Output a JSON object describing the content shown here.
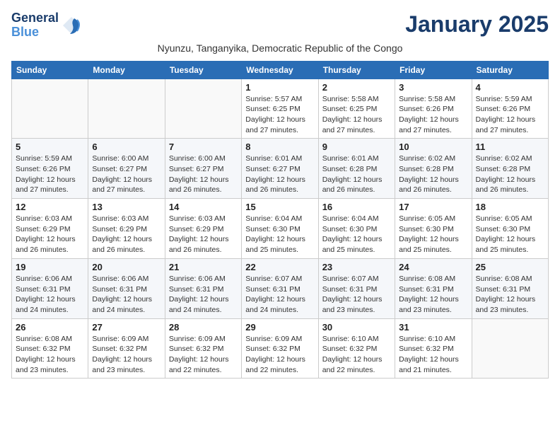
{
  "header": {
    "logo_line1": "General",
    "logo_line2": "Blue",
    "month_title": "January 2025",
    "subtitle": "Nyunzu, Tanganyika, Democratic Republic of the Congo"
  },
  "weekdays": [
    "Sunday",
    "Monday",
    "Tuesday",
    "Wednesday",
    "Thursday",
    "Friday",
    "Saturday"
  ],
  "weeks": [
    [
      {
        "day": "",
        "info": ""
      },
      {
        "day": "",
        "info": ""
      },
      {
        "day": "",
        "info": ""
      },
      {
        "day": "1",
        "info": "Sunrise: 5:57 AM\nSunset: 6:25 PM\nDaylight: 12 hours\nand 27 minutes."
      },
      {
        "day": "2",
        "info": "Sunrise: 5:58 AM\nSunset: 6:25 PM\nDaylight: 12 hours\nand 27 minutes."
      },
      {
        "day": "3",
        "info": "Sunrise: 5:58 AM\nSunset: 6:26 PM\nDaylight: 12 hours\nand 27 minutes."
      },
      {
        "day": "4",
        "info": "Sunrise: 5:59 AM\nSunset: 6:26 PM\nDaylight: 12 hours\nand 27 minutes."
      }
    ],
    [
      {
        "day": "5",
        "info": "Sunrise: 5:59 AM\nSunset: 6:26 PM\nDaylight: 12 hours\nand 27 minutes."
      },
      {
        "day": "6",
        "info": "Sunrise: 6:00 AM\nSunset: 6:27 PM\nDaylight: 12 hours\nand 27 minutes."
      },
      {
        "day": "7",
        "info": "Sunrise: 6:00 AM\nSunset: 6:27 PM\nDaylight: 12 hours\nand 26 minutes."
      },
      {
        "day": "8",
        "info": "Sunrise: 6:01 AM\nSunset: 6:27 PM\nDaylight: 12 hours\nand 26 minutes."
      },
      {
        "day": "9",
        "info": "Sunrise: 6:01 AM\nSunset: 6:28 PM\nDaylight: 12 hours\nand 26 minutes."
      },
      {
        "day": "10",
        "info": "Sunrise: 6:02 AM\nSunset: 6:28 PM\nDaylight: 12 hours\nand 26 minutes."
      },
      {
        "day": "11",
        "info": "Sunrise: 6:02 AM\nSunset: 6:28 PM\nDaylight: 12 hours\nand 26 minutes."
      }
    ],
    [
      {
        "day": "12",
        "info": "Sunrise: 6:03 AM\nSunset: 6:29 PM\nDaylight: 12 hours\nand 26 minutes."
      },
      {
        "day": "13",
        "info": "Sunrise: 6:03 AM\nSunset: 6:29 PM\nDaylight: 12 hours\nand 26 minutes."
      },
      {
        "day": "14",
        "info": "Sunrise: 6:03 AM\nSunset: 6:29 PM\nDaylight: 12 hours\nand 26 minutes."
      },
      {
        "day": "15",
        "info": "Sunrise: 6:04 AM\nSunset: 6:30 PM\nDaylight: 12 hours\nand 25 minutes."
      },
      {
        "day": "16",
        "info": "Sunrise: 6:04 AM\nSunset: 6:30 PM\nDaylight: 12 hours\nand 25 minutes."
      },
      {
        "day": "17",
        "info": "Sunrise: 6:05 AM\nSunset: 6:30 PM\nDaylight: 12 hours\nand 25 minutes."
      },
      {
        "day": "18",
        "info": "Sunrise: 6:05 AM\nSunset: 6:30 PM\nDaylight: 12 hours\nand 25 minutes."
      }
    ],
    [
      {
        "day": "19",
        "info": "Sunrise: 6:06 AM\nSunset: 6:31 PM\nDaylight: 12 hours\nand 24 minutes."
      },
      {
        "day": "20",
        "info": "Sunrise: 6:06 AM\nSunset: 6:31 PM\nDaylight: 12 hours\nand 24 minutes."
      },
      {
        "day": "21",
        "info": "Sunrise: 6:06 AM\nSunset: 6:31 PM\nDaylight: 12 hours\nand 24 minutes."
      },
      {
        "day": "22",
        "info": "Sunrise: 6:07 AM\nSunset: 6:31 PM\nDaylight: 12 hours\nand 24 minutes."
      },
      {
        "day": "23",
        "info": "Sunrise: 6:07 AM\nSunset: 6:31 PM\nDaylight: 12 hours\nand 23 minutes."
      },
      {
        "day": "24",
        "info": "Sunrise: 6:08 AM\nSunset: 6:31 PM\nDaylight: 12 hours\nand 23 minutes."
      },
      {
        "day": "25",
        "info": "Sunrise: 6:08 AM\nSunset: 6:31 PM\nDaylight: 12 hours\nand 23 minutes."
      }
    ],
    [
      {
        "day": "26",
        "info": "Sunrise: 6:08 AM\nSunset: 6:32 PM\nDaylight: 12 hours\nand 23 minutes."
      },
      {
        "day": "27",
        "info": "Sunrise: 6:09 AM\nSunset: 6:32 PM\nDaylight: 12 hours\nand 23 minutes."
      },
      {
        "day": "28",
        "info": "Sunrise: 6:09 AM\nSunset: 6:32 PM\nDaylight: 12 hours\nand 22 minutes."
      },
      {
        "day": "29",
        "info": "Sunrise: 6:09 AM\nSunset: 6:32 PM\nDaylight: 12 hours\nand 22 minutes."
      },
      {
        "day": "30",
        "info": "Sunrise: 6:10 AM\nSunset: 6:32 PM\nDaylight: 12 hours\nand 22 minutes."
      },
      {
        "day": "31",
        "info": "Sunrise: 6:10 AM\nSunset: 6:32 PM\nDaylight: 12 hours\nand 21 minutes."
      },
      {
        "day": "",
        "info": ""
      }
    ]
  ]
}
